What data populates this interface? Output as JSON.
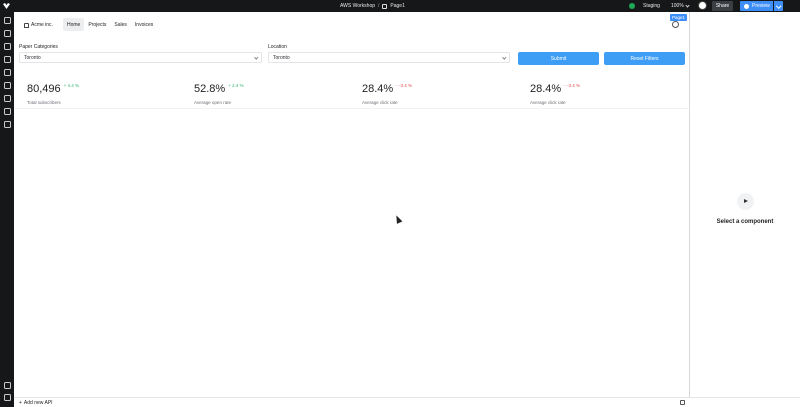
{
  "topbar": {
    "workspace": "AWS Workshop",
    "separator": "/",
    "page": "Page1",
    "environment": "Staging",
    "zoom": "100%",
    "share_label": "Share",
    "preview_label": "Preview"
  },
  "header": {
    "brand": "Acme inc.",
    "page_tag": "Page1",
    "nav": [
      "Home",
      "Projects",
      "Sales",
      "Invoices"
    ]
  },
  "filters": {
    "category_label": "Paper Categories",
    "category_value": "Toronto",
    "location_label": "Location",
    "location_value": "Toronto",
    "submit_label": "Submit",
    "reset_label": "Reset Filters"
  },
  "stats": [
    {
      "value": "80,496",
      "delta": "+ 4.4 %",
      "label": "Total subscribers"
    },
    {
      "value": "52.8%",
      "delta": "+ 2.4 %",
      "label": "Average open rate"
    },
    {
      "value": "28.4%",
      "delta": "- -3.4 %",
      "label": "Average click rate"
    },
    {
      "value": "28.4%",
      "delta": "- -3.4 %",
      "label": "Average click rate"
    }
  ],
  "right_panel": {
    "empty_text": "Select a component"
  },
  "bottombar": {
    "add_api": "Add new API"
  }
}
